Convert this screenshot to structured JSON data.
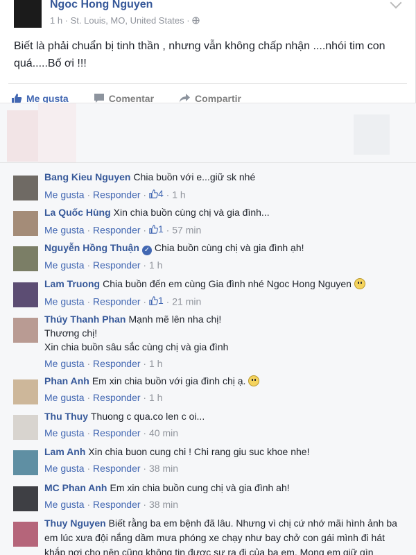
{
  "post": {
    "author": "Ngoc Hong Nguyen",
    "meta": "1 h · St. Louis, MO, United States · ",
    "text": "Biết là phải chuẩn bị tinh thần , nhưng vẫn không chấp nhận ....nhói tim con quá.....Bố ơi !!!",
    "like_label": "Me gusta",
    "comment_label": "Comentar",
    "share_label": "Compartir"
  },
  "colors": {
    "link": "#365899",
    "accent": "#4267b2",
    "muted": "#90949c"
  },
  "comments": [
    {
      "name": "Bang Kieu Nguyen",
      "text": "Chia buồn với e...giữ sk nhé",
      "like": "Me gusta",
      "reply": "Responder",
      "likes": "4",
      "time": "1 h"
    },
    {
      "name": "La Quốc Hùng",
      "text": "Xin chia buồn cùng chị và gia đình...",
      "like": "Me gusta",
      "reply": "Responder",
      "likes": "1",
      "time": "57 min"
    },
    {
      "name": "Nguyễn Hồng Thuận",
      "text": "Chia buồn cùng chị và gia đình ạh!",
      "like": "Me gusta",
      "reply": "Responder",
      "likes": "",
      "time": "1 h"
    },
    {
      "name": "Lam Truong",
      "text": "Chia buồn đến em cùng Gia đình nhé Ngoc Hong Nguyen",
      "like": "Me gusta",
      "reply": "Responder",
      "likes": "1",
      "time": "21 min"
    },
    {
      "name": "Thúy Thanh Phan",
      "text": "Mạnh mẽ lên nha chị!",
      "text2": "Thương chị!",
      "text3": "Xin chia buồn sâu sắc cùng chị và gia đình",
      "like": "Me gusta",
      "reply": "Responder",
      "likes": "",
      "time": "1 h"
    },
    {
      "name": "Phan Anh",
      "text": "Em xin chia buồn với gia đình chị ạ.",
      "like": "Me gusta",
      "reply": "Responder",
      "likes": "",
      "time": "1 h"
    },
    {
      "name": "Thu Thuy",
      "text": "Thuong c qua.co len c oi...",
      "like": "Me gusta",
      "reply": "Responder",
      "likes": "",
      "time": "40 min"
    },
    {
      "name": "Lam Anh",
      "text": "Xin chia buon cung chi ! Chi rang giu suc khoe nhe!",
      "like": "Me gusta",
      "reply": "Responder",
      "likes": "",
      "time": "38 min"
    },
    {
      "name": "MC Phan Anh",
      "text": "Em xin chia buồn cung chị và gia đình ah!",
      "like": "Me gusta",
      "reply": "Responder",
      "likes": "",
      "time": "38 min"
    },
    {
      "name": "Thuy Nguyen",
      "text": "Biết rằng ba em bệnh đã lâu. Nhưng vì chị cứ nhớ mãi hình ảnh ba em lúc xưa đội nắng dầm mưa phóng xe chạy như bay chở con gái mình đi hát khắp nơi cho nên cũng không tin được sự ra đi của ba em. Mong em giữ gìn"
    }
  ]
}
